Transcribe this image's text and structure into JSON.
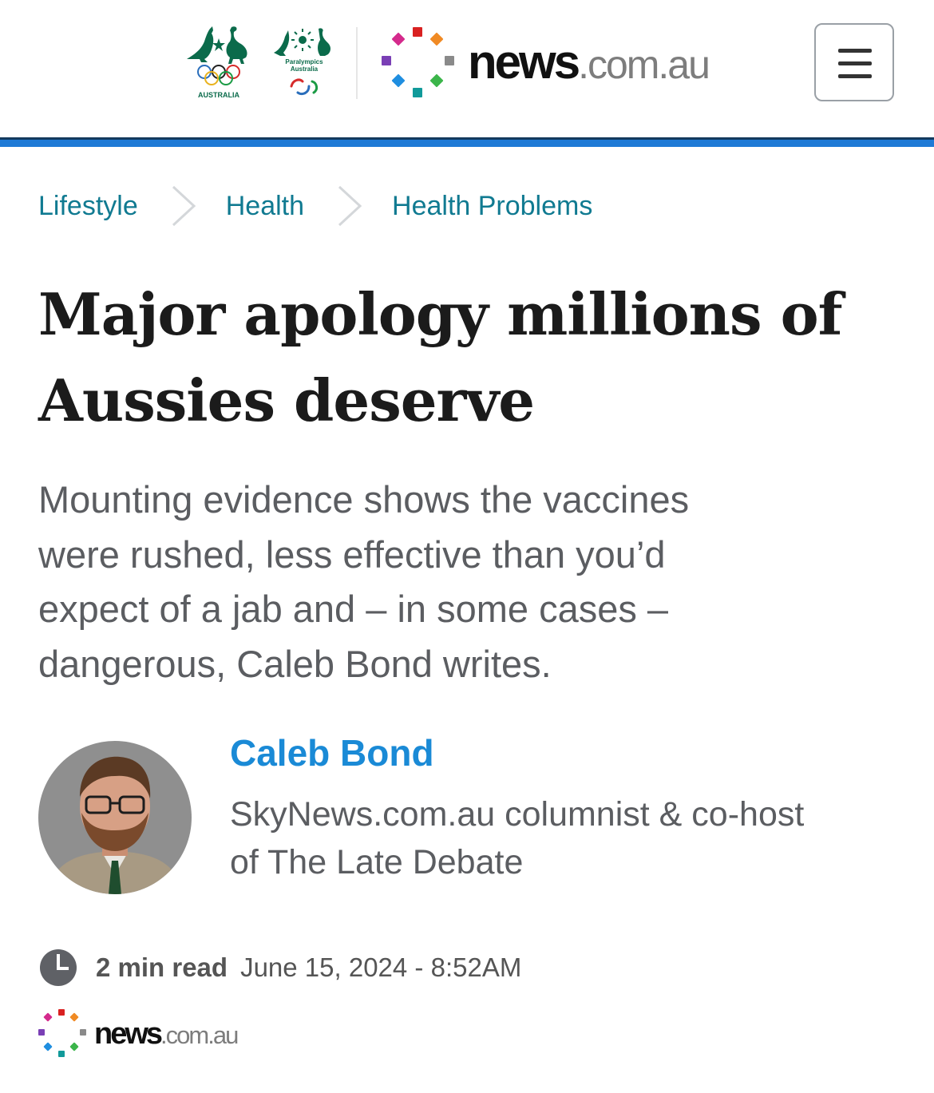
{
  "header": {
    "aoc_logo": {
      "icon": "australian-olympic-committee-logo",
      "caption": "AUSTRALIA"
    },
    "pa_logo": {
      "icon": "paralympics-australia-logo",
      "caption_line1": "Paralympics",
      "caption_line2": "Australia"
    },
    "site_logo": {
      "icon": "news-com-au-logo",
      "word_main": "news",
      "word_domain": ".com.au"
    },
    "menu_button": {
      "icon": "hamburger-menu-icon"
    }
  },
  "breadcrumb": [
    {
      "label": "Lifestyle"
    },
    {
      "label": "Health"
    },
    {
      "label": "Health Problems"
    }
  ],
  "article": {
    "headline_line1": "Major apology millions of",
    "headline_line2": "Aussies deserve",
    "standfirst_line1": "Mounting evidence shows the vaccines",
    "standfirst_line2": "were rushed, less effective than you’d",
    "standfirst_line3": "expect of a jab and – in some cases –",
    "standfirst_line4": "dangerous, Caleb Bond writes."
  },
  "author": {
    "name": "Caleb Bond",
    "bio_line1": "SkyNews.com.au columnist & co-host",
    "bio_line2": "of The Late Debate",
    "avatar_icon": "author-avatar"
  },
  "meta": {
    "clock_icon": "clock-icon",
    "read_time": "2 min read",
    "published": "June 15, 2024 - 8:52AM"
  },
  "source": {
    "icon": "news-com-au-logo",
    "word_main": "news",
    "word_domain": ".com.au"
  },
  "colors": {
    "link": "#107a91",
    "author": "#1a8ad6",
    "header_rule": "#1f7ad6",
    "headline": "#1b1b1b",
    "body_text": "#5b5d61"
  }
}
